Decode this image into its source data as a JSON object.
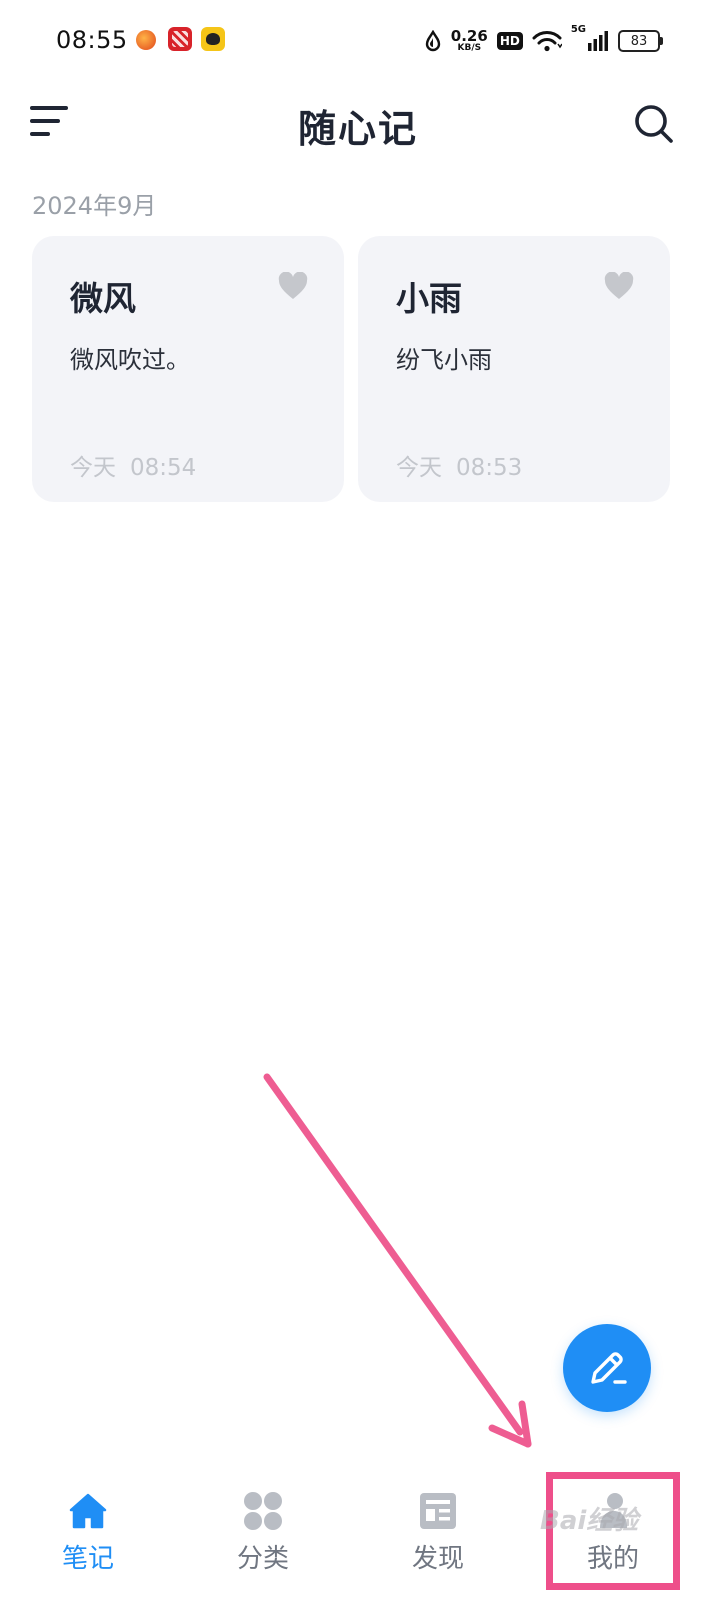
{
  "status_bar": {
    "time": "08:55",
    "net_speed_value": "0.26",
    "net_speed_unit": "KB/S",
    "hd": "HD",
    "signal_type": "5G",
    "battery": "83"
  },
  "header": {
    "title": "随心记"
  },
  "notes": {
    "section_date": "2024年9月",
    "items": [
      {
        "title": "微风",
        "body": "微风吹过。",
        "day": "今天",
        "time": "08:54"
      },
      {
        "title": "小雨",
        "body": "纷飞小雨",
        "day": "今天",
        "time": "08:53"
      }
    ]
  },
  "bottom_nav": {
    "tabs": [
      {
        "label": "笔记",
        "icon": "home-icon",
        "active": true
      },
      {
        "label": "分类",
        "icon": "category-grid-icon",
        "active": false
      },
      {
        "label": "发现",
        "icon": "news-icon",
        "active": false
      },
      {
        "label": "我的",
        "icon": "profile-icon",
        "active": false
      }
    ]
  },
  "watermark": "Bai经验",
  "colors": {
    "accent": "#1f8ef5",
    "annotation": "#ee4f8a",
    "card_bg": "#f3f4f8"
  }
}
